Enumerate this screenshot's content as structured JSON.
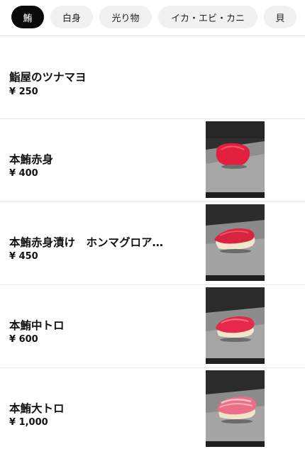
{
  "tabs": [
    {
      "label": "鮪",
      "active": true
    },
    {
      "label": "白身",
      "active": false
    },
    {
      "label": "光り物",
      "active": false
    },
    {
      "label": "イカ・エビ・カニ",
      "active": false
    },
    {
      "label": "貝",
      "active": false
    }
  ],
  "items": [
    {
      "name": "鮨屋のツナマヨ",
      "price": "¥ 250",
      "image": null
    },
    {
      "name": "本鮪赤身",
      "price": "¥ 400",
      "image": "akami-sushi-photo"
    },
    {
      "name": "本鮪赤身漬け　ホンマグロア…",
      "price": "¥ 450",
      "image": "zuke-sushi-photo"
    },
    {
      "name": "本鮪中トロ",
      "price": "¥ 600",
      "image": "chutoro-sushi-photo"
    },
    {
      "name": "本鮪大トロ",
      "price": "¥ 1,000",
      "image": "otoro-sushi-photo"
    }
  ],
  "colors": {
    "active_tab_bg": "#0a0a0a",
    "tab_bg": "#f1f1f1",
    "tuna_red": "#e8203f",
    "backdrop_dark": "#2b2b2b"
  }
}
